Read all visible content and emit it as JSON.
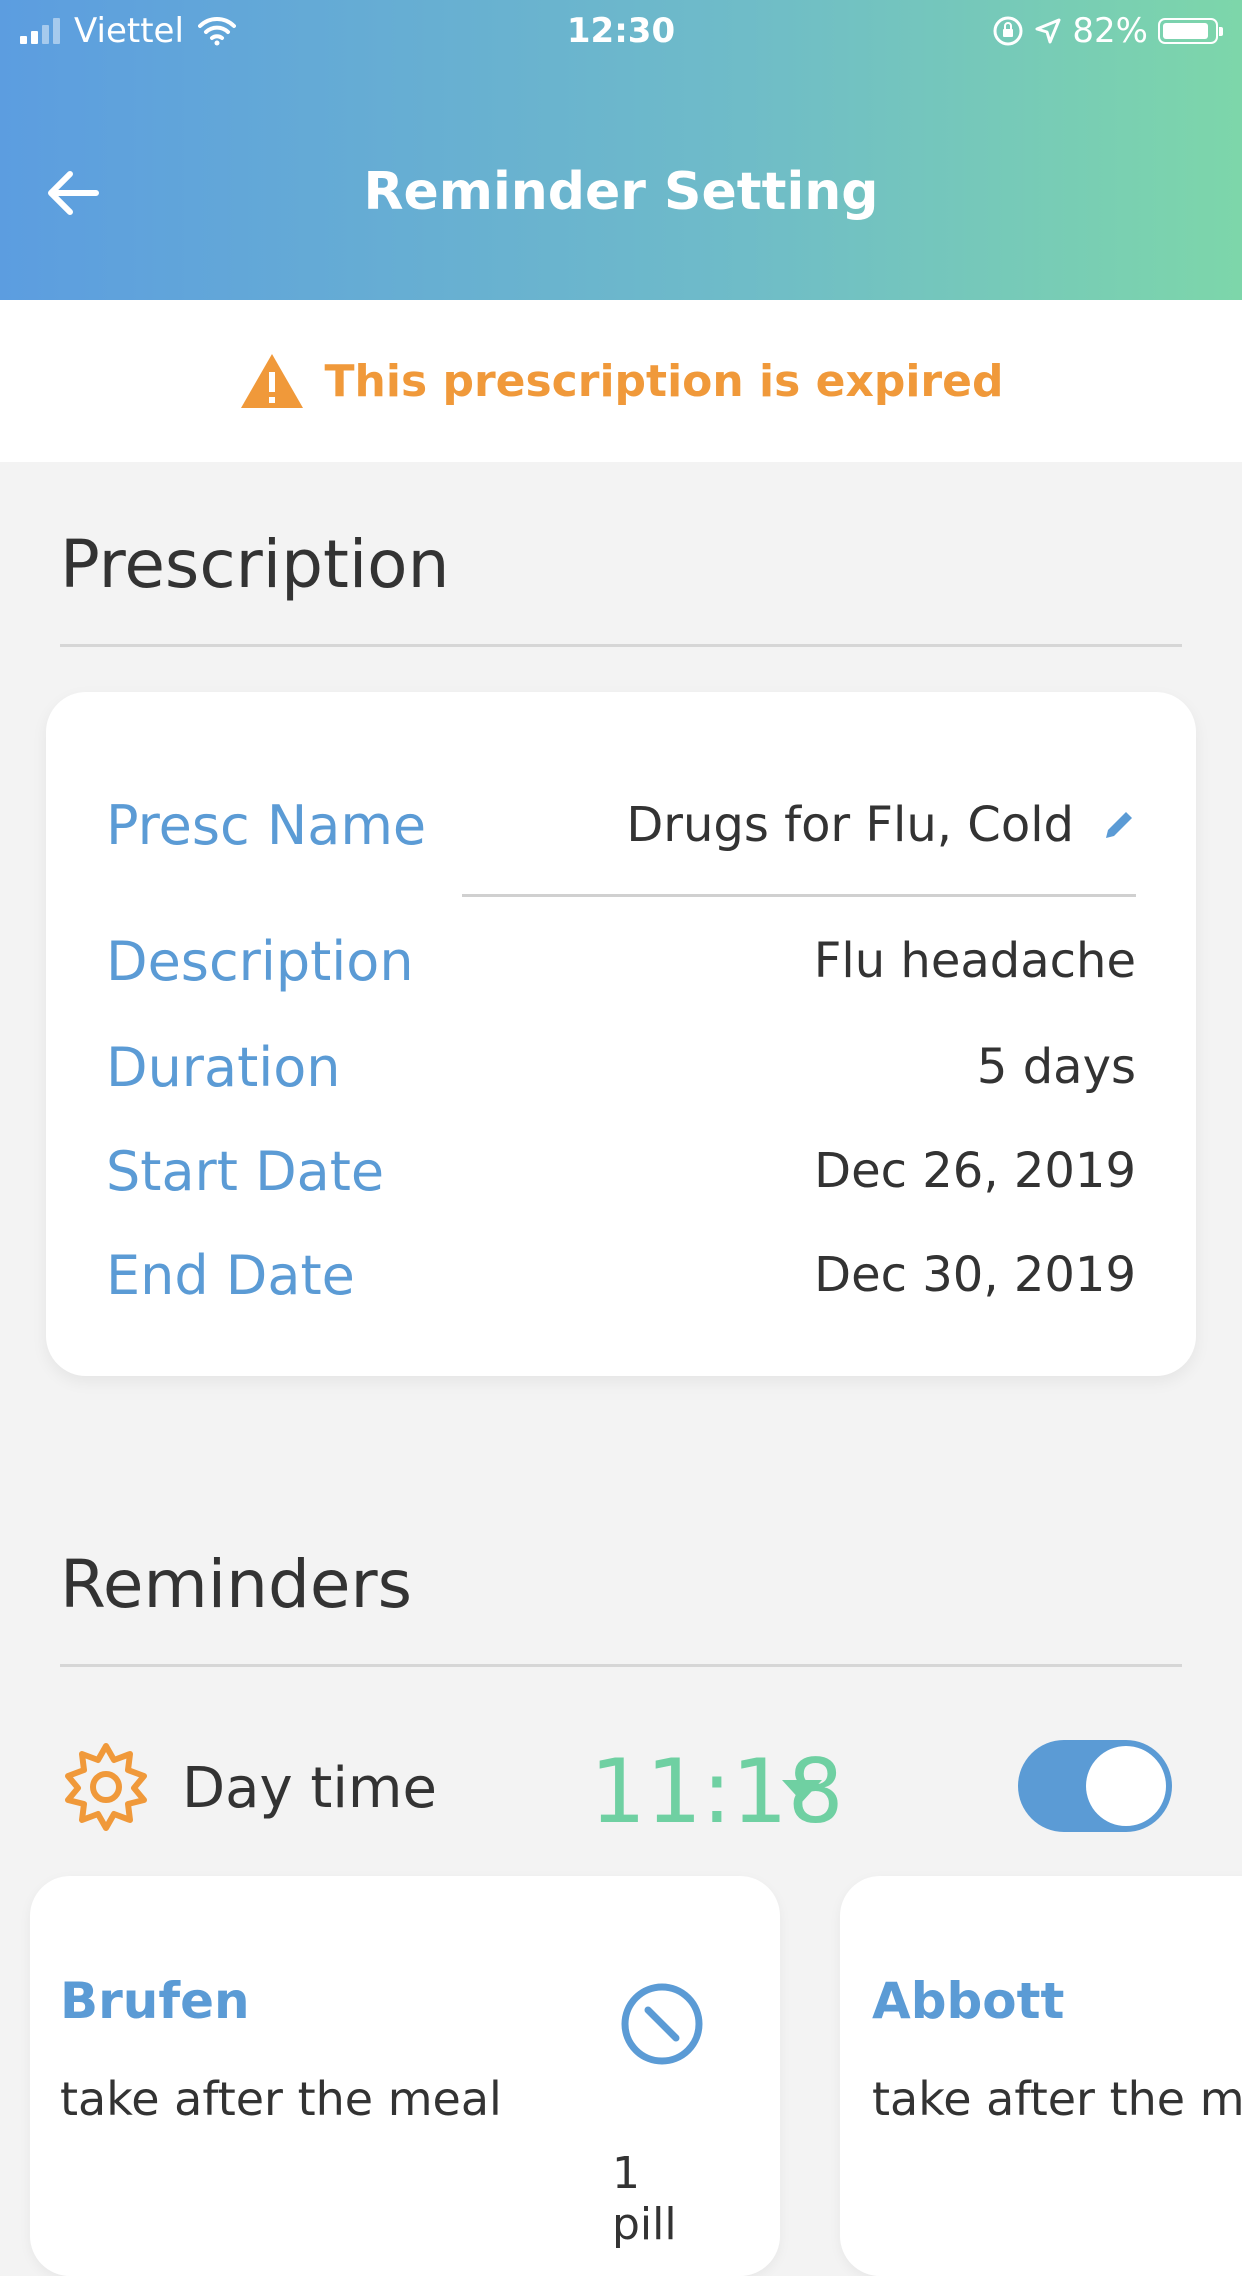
{
  "status_bar": {
    "carrier": "Viettel",
    "time": "12:30",
    "battery": "82%",
    "icons": [
      "signal-icon",
      "wifi-icon",
      "rotation-lock-icon",
      "location-arrow-icon",
      "battery-icon"
    ]
  },
  "header": {
    "title": "Reminder Setting",
    "back_icon": "arrow-left-icon"
  },
  "banner": {
    "text": "This prescription is expired",
    "icon": "warning-triangle-icon",
    "color": "#f0993a"
  },
  "prescription": {
    "section_title": "Prescription",
    "edit_icon": "pencil-icon",
    "fields": [
      {
        "label": "Presc Name",
        "value": "Drugs for Flu, Cold"
      },
      {
        "label": "Description",
        "value": "Flu headache"
      },
      {
        "label": "Duration",
        "value": "5 days"
      },
      {
        "label": "Start Date",
        "value": "Dec 26, 2019"
      },
      {
        "label": "End Date",
        "value": "Dec 30, 2019"
      }
    ]
  },
  "reminders": {
    "section_title": "Reminders",
    "slot": {
      "icon": "sun-icon",
      "label": "Day time",
      "time": "11:18",
      "enabled": true
    },
    "medicines": [
      {
        "name": "Brufen",
        "note": "take after the meal",
        "dose": "1 pill",
        "icon": "no-entry-icon"
      },
      {
        "name": "Abbott",
        "note": "take after the meal",
        "dose": "",
        "icon": ""
      }
    ]
  },
  "colors": {
    "accent_blue": "#5b9bd5",
    "accent_green": "#6fd0a2",
    "warning_orange": "#f0993a",
    "header_gradient_start": "#5c9de0",
    "header_gradient_end": "#7dd6aa"
  }
}
